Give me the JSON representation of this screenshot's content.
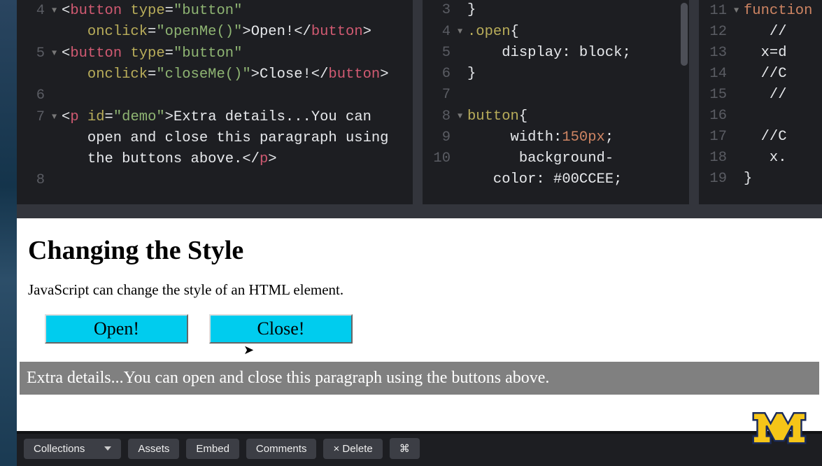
{
  "html_panel": {
    "lines": [
      {
        "n": "4",
        "fold": true,
        "html": "<span class='punct'>&lt;</span><span class='tag'>button</span> <span class='attr'>type</span><span class='punct'>=</span><span class='string'>\"button\"</span>"
      },
      {
        "n": "",
        "fold": false,
        "html": "   <span class='attr'>onclick</span><span class='punct'>=</span><span class='string'>\"openMe()\"</span><span class='punct'>&gt;</span><span class='txt'>Open!</span><span class='punct'>&lt;/</span><span class='tag'>button</span><span class='punct'>&gt;</span>"
      },
      {
        "n": "5",
        "fold": true,
        "html": "<span class='punct'>&lt;</span><span class='tag'>button</span> <span class='attr'>type</span><span class='punct'>=</span><span class='string'>\"button\"</span>"
      },
      {
        "n": "",
        "fold": false,
        "html": "   <span class='attr'>onclick</span><span class='punct'>=</span><span class='string'>\"closeMe()\"</span><span class='punct'>&gt;</span><span class='txt'>Close!</span><span class='punct'>&lt;/</span><span class='tag'>button</span><span class='punct'>&gt;</span>"
      },
      {
        "n": "6",
        "fold": false,
        "html": ""
      },
      {
        "n": "7",
        "fold": true,
        "html": "<span class='punct'>&lt;</span><span class='tag'>p</span> <span class='attr'>id</span><span class='punct'>=</span><span class='string'>\"demo\"</span><span class='punct'>&gt;</span><span class='txt'>Extra details...You can</span>"
      },
      {
        "n": "",
        "fold": false,
        "html": "   <span class='txt'>open and close this paragraph using</span>"
      },
      {
        "n": "",
        "fold": false,
        "html": "   <span class='txt'>the buttons above.</span><span class='punct'>&lt;/</span><span class='tag'>p</span><span class='punct'>&gt;</span>"
      },
      {
        "n": "8",
        "fold": false,
        "html": ""
      }
    ]
  },
  "css_panel": {
    "lines": [
      {
        "n": "3",
        "fold": false,
        "html": "<span class='brace'>}</span>"
      },
      {
        "n": "4",
        "fold": true,
        "html": "<span class='sel'>.open</span><span class='brace'>{</span>"
      },
      {
        "n": "5",
        "fold": false,
        "html": "    <span class='prop'>display: block;</span>"
      },
      {
        "n": "6",
        "fold": false,
        "html": "<span class='brace'>}</span>"
      },
      {
        "n": "7",
        "fold": false,
        "html": ""
      },
      {
        "n": "8",
        "fold": true,
        "html": "<span class='sel'>button</span><span class='brace'>{</span>"
      },
      {
        "n": "9",
        "fold": false,
        "html": "     <span class='prop'>width:</span><span class='num'>150px</span><span class='prop'>;</span>"
      },
      {
        "n": "10",
        "fold": false,
        "html": "      <span class='prop'>background-</span>"
      },
      {
        "n": "",
        "fold": false,
        "html": "   <span class='prop'>color: </span><span class='hex'>#00CCEE;</span>"
      }
    ]
  },
  "js_panel": {
    "lines": [
      {
        "n": "11",
        "fold": true,
        "html": "<span class='kw'>function</span>"
      },
      {
        "n": "12",
        "fold": false,
        "html": "   <span class='plain'>//</span>"
      },
      {
        "n": "13",
        "fold": false,
        "html": "  <span class='plain'>x=d</span>"
      },
      {
        "n": "14",
        "fold": false,
        "html": "  <span class='plain'>//C</span>"
      },
      {
        "n": "15",
        "fold": false,
        "html": "   <span class='plain'>//</span>"
      },
      {
        "n": "16",
        "fold": false,
        "html": ""
      },
      {
        "n": "17",
        "fold": false,
        "html": "  <span class='plain'>//C</span>"
      },
      {
        "n": "18",
        "fold": false,
        "html": "   <span class='plain'>x.</span>"
      },
      {
        "n": "19",
        "fold": false,
        "html": "<span class='brace'>}</span>"
      }
    ]
  },
  "output": {
    "heading": "Changing the Style",
    "lead": "JavaScript can change the style of an HTML element.",
    "open_label": "Open!",
    "close_label": "Close!",
    "demo_text": "Extra details...You can open and close this paragraph using the buttons above."
  },
  "footer": {
    "collections": "Collections",
    "assets": "Assets",
    "embed": "Embed",
    "comments": "Comments",
    "delete": "× Delete",
    "cmd": "⌘"
  }
}
